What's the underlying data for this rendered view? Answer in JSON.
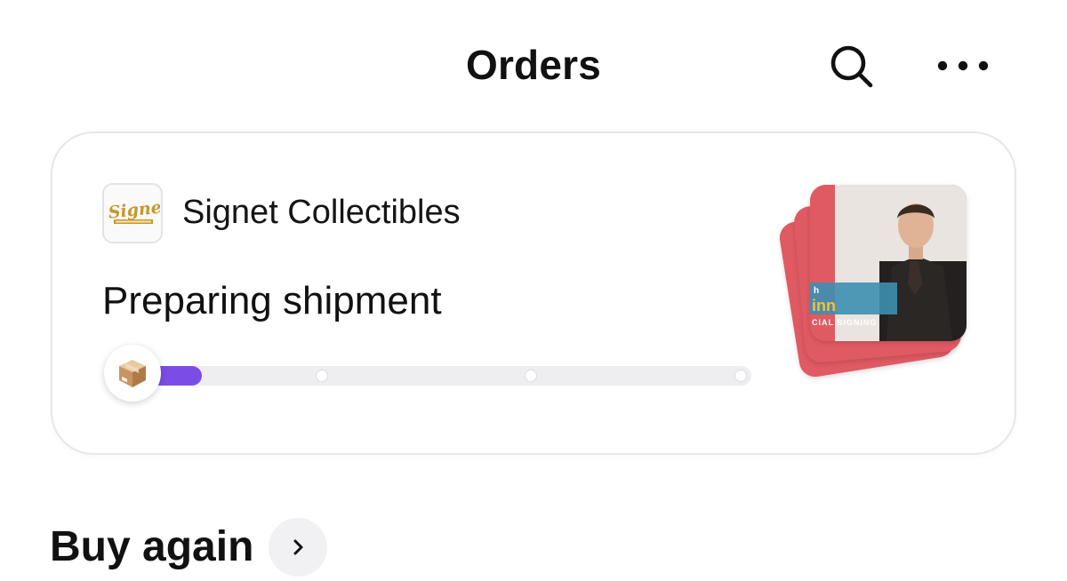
{
  "header": {
    "title": "Orders",
    "search_icon": "search-icon",
    "more_icon": "more-horizontal-icon"
  },
  "order": {
    "shop": {
      "name": "Signet Collectibles",
      "logo_text": "Signet"
    },
    "status": "Preparing shipment",
    "progress": {
      "fraction": 0.07,
      "steps": 4,
      "icon": "package-box-icon",
      "accent_color": "#7c4ce6"
    },
    "product_image": {
      "banner_prefix": "h",
      "banner_name": "inn",
      "banner_sub": "CIAL SIGNING",
      "card_color": "#e05a63"
    }
  },
  "buy_again": {
    "label": "Buy again",
    "icon": "chevron-right-icon"
  }
}
